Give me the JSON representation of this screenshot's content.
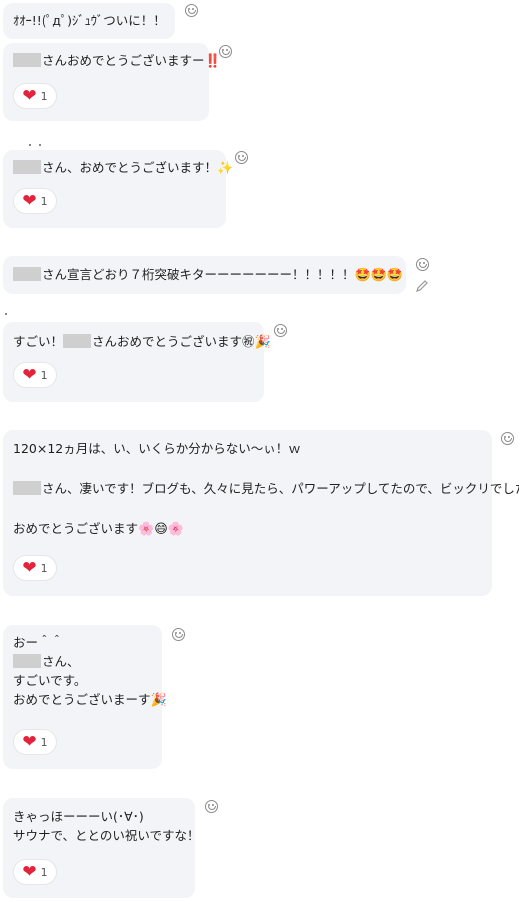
{
  "messages": [
    {
      "id": "m1",
      "line": "ｵｵｰ!!(ﾟдﾟ)ｼﾞｭｳﾞついに！！"
    },
    {
      "id": "m2",
      "text": "さんおめでとうございますー",
      "emoji": "‼️",
      "reaction_count": "1"
    },
    {
      "id": "m3",
      "text": "さん、おめでとうございます！",
      "emoji": "✨",
      "reaction_count": "1"
    },
    {
      "id": "m4",
      "text": "さん宣言どおり７桁突破キターーーーーーー！！！！！",
      "emoji": "🤩🤩🤩"
    },
    {
      "id": "m5",
      "prefix": "すごい！",
      "text": "さんおめでとうございます㊗",
      "emoji": "🎉",
      "reaction_count": "1"
    },
    {
      "id": "m6",
      "line1": "120×12ヵ月は、い、いくらか分からない〜ぃ！ｗ",
      "line2": "さん、凄いです！ブログも、久々に見たら、パワーアップしてたので、ビックリでした！",
      "line3": "おめでとうございます",
      "emoji": "🌸😄🌸",
      "reaction_count": "1"
    },
    {
      "id": "m7",
      "line1": "おー＾＾",
      "line2": "さん、",
      "line3": "すごいです。",
      "line4": "おめでとうございまーす",
      "emoji": "🎉",
      "reaction_count": "1"
    },
    {
      "id": "m8",
      "line1": "きゃっほーーーい(･∀･)",
      "line2": "サウナで、ととのい祝いですな！",
      "reaction_count": "1"
    }
  ],
  "icons": {
    "reaction": "heart-icon",
    "add_reaction": "smiley-icon",
    "edit": "pencil-icon"
  },
  "colors": {
    "bubble": "#f3f4f7",
    "heart": "#e3223b",
    "redaction": "#cfcfcf"
  }
}
